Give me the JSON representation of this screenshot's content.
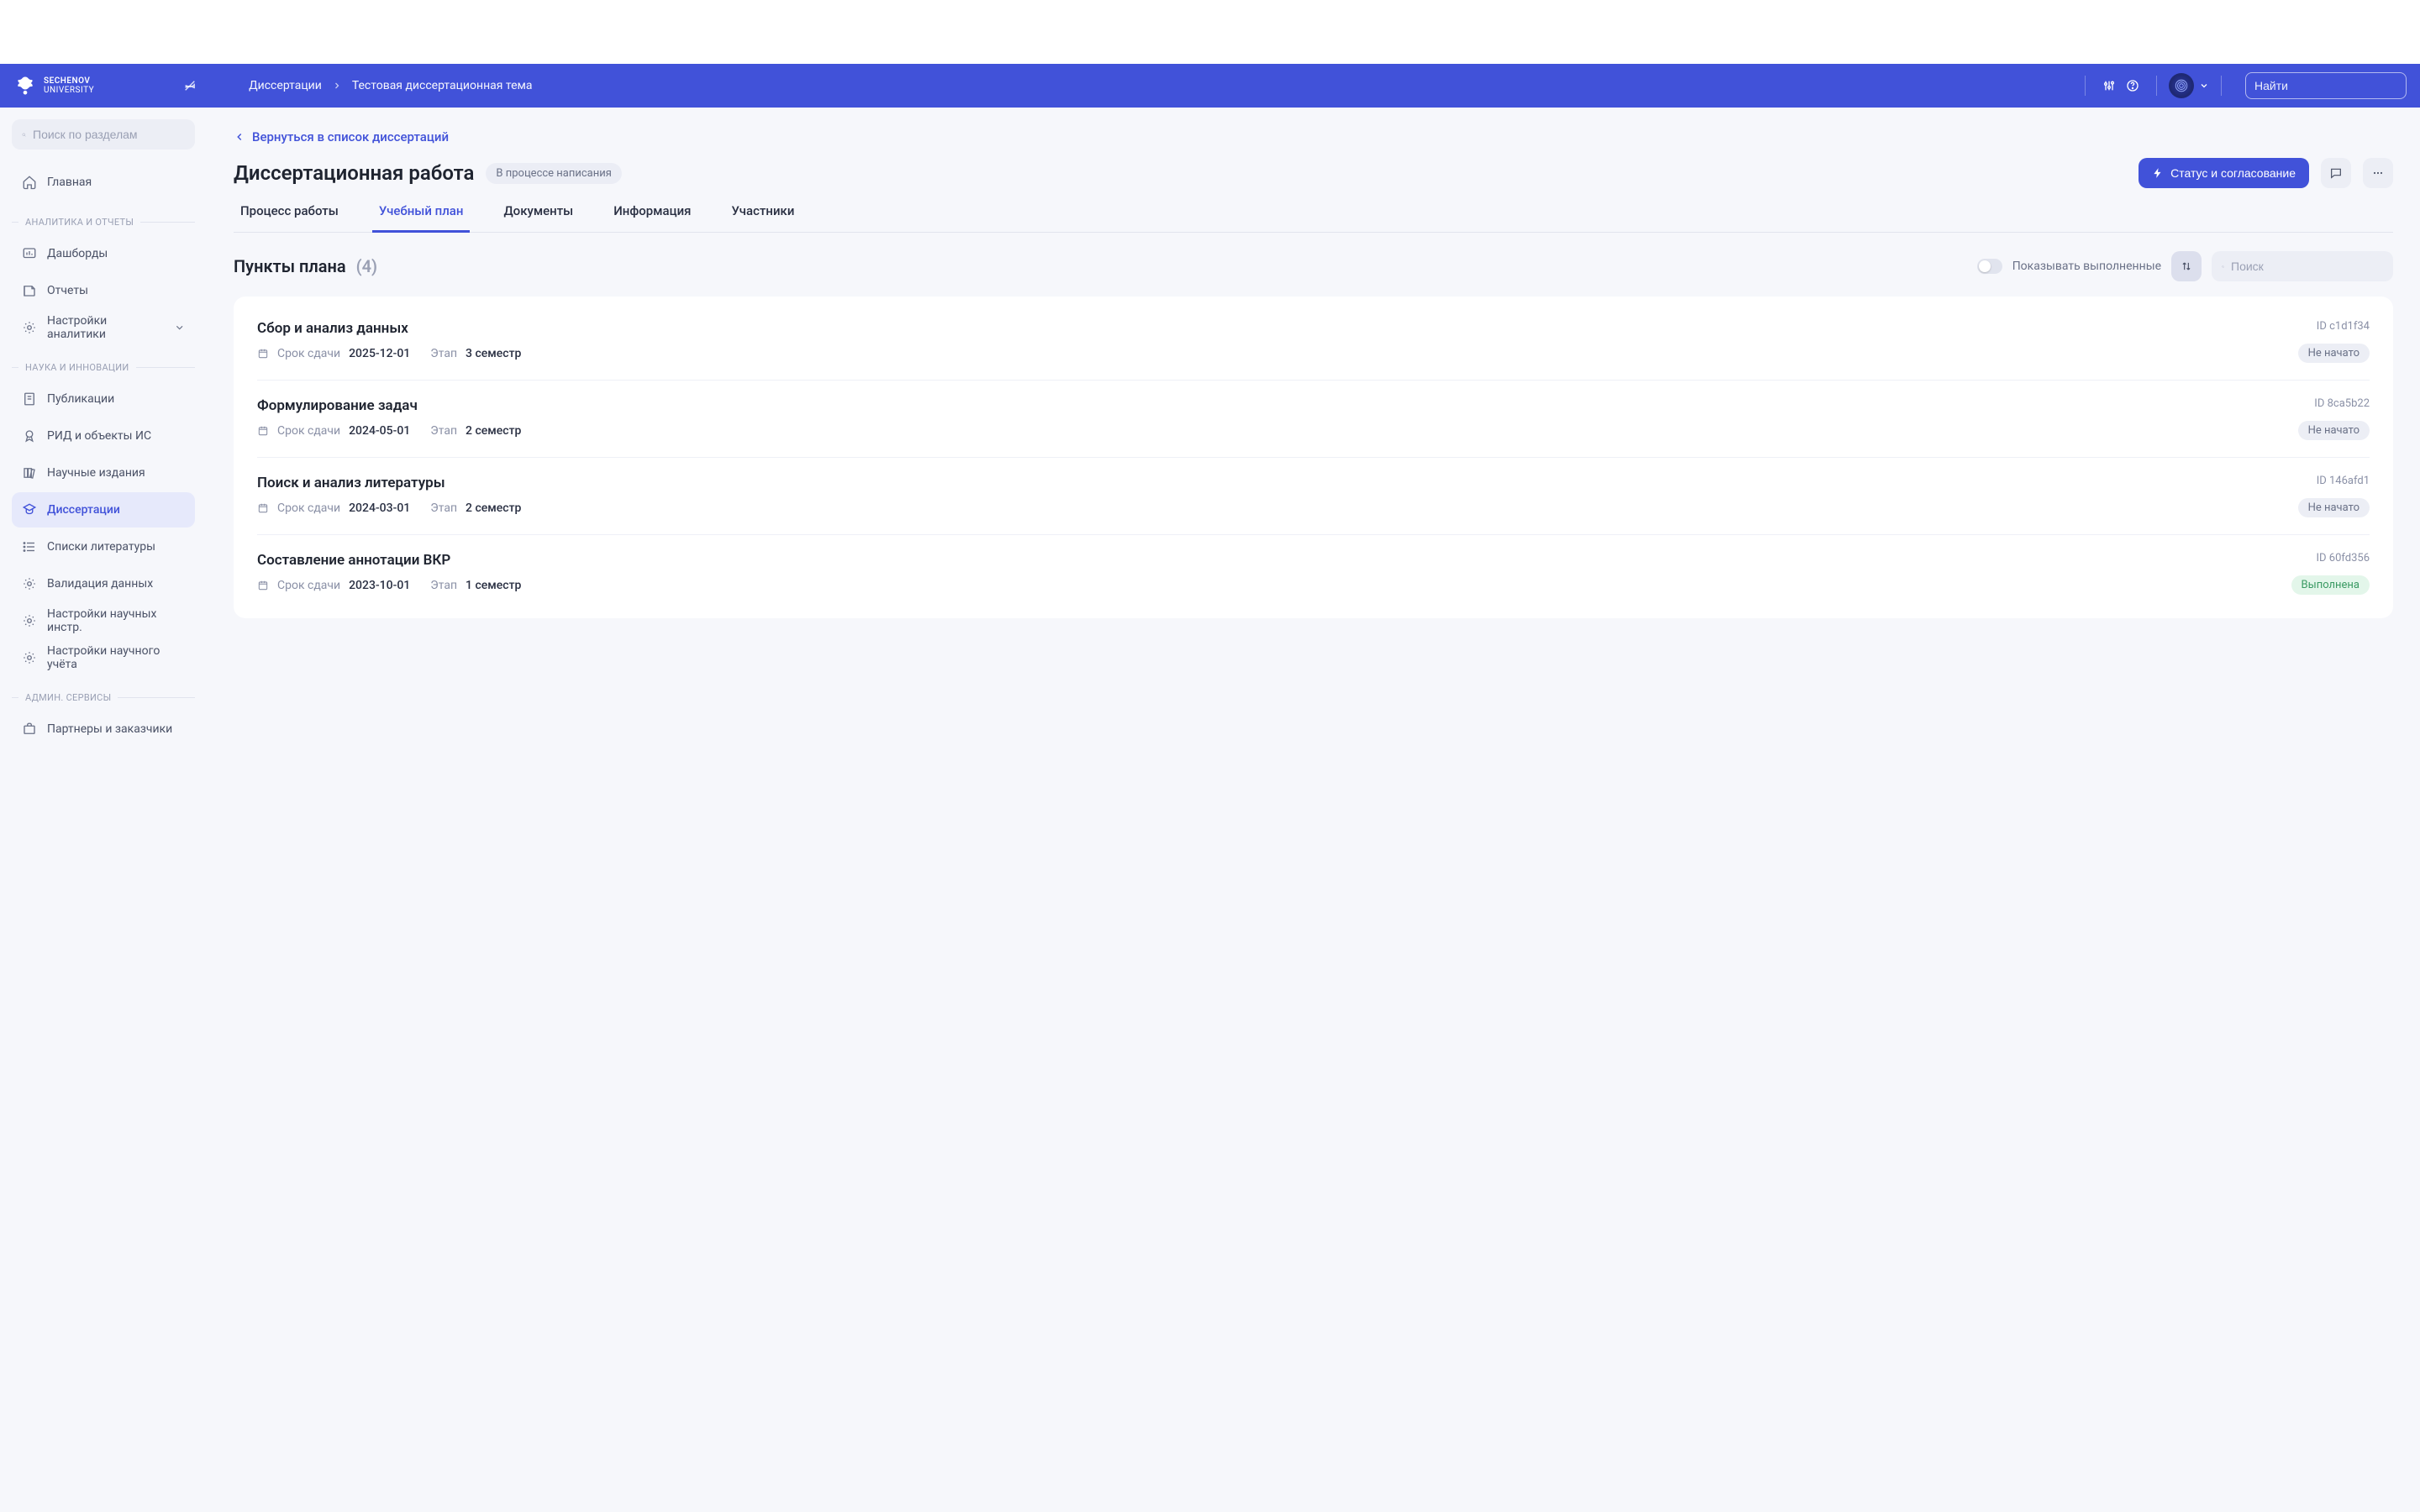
{
  "brand": {
    "line1": "SECHENOV",
    "line2": "UNIVERSITY"
  },
  "breadcrumb": {
    "root": "Диссертации",
    "current": "Тестовая диссертационная тема"
  },
  "global_search_placeholder": "Найти",
  "sidebar": {
    "search_placeholder": "Поиск по разделам",
    "home": "Главная",
    "sections": [
      {
        "label": "АНАЛИТИКА И ОТЧЕТЫ",
        "items": [
          {
            "key": "dashboards",
            "label": "Дашборды"
          },
          {
            "key": "reports",
            "label": "Отчеты"
          },
          {
            "key": "analytics-settings",
            "label": "Настройки аналитики",
            "chevron": true
          }
        ]
      },
      {
        "label": "НАУКА И ИННОВАЦИИ",
        "items": [
          {
            "key": "publications",
            "label": "Публикации"
          },
          {
            "key": "rid",
            "label": "РИД и объекты ИС"
          },
          {
            "key": "journals",
            "label": "Научные издания"
          },
          {
            "key": "dissertations",
            "label": "Диссертации",
            "active": true
          },
          {
            "key": "bibliography",
            "label": "Списки литературы"
          },
          {
            "key": "validation",
            "label": "Валидация данных"
          },
          {
            "key": "sci-tools-settings",
            "label": "Настройки научных инстр."
          },
          {
            "key": "sci-account-settings",
            "label": "Настройки научного учёта"
          }
        ]
      },
      {
        "label": "АДМИН. СЕРВИСЫ",
        "items": [
          {
            "key": "partners",
            "label": "Партнеры и заказчики"
          }
        ]
      }
    ]
  },
  "back_link": "Вернуться в список диссертаций",
  "page_title": "Диссертационная работа",
  "status_badge": "В процессе написания",
  "primary_button": "Статус и согласование",
  "tabs": [
    {
      "key": "process",
      "label": "Процесс работы"
    },
    {
      "key": "plan",
      "label": "Учебный план",
      "active": true
    },
    {
      "key": "documents",
      "label": "Документы"
    },
    {
      "key": "info",
      "label": "Информация"
    },
    {
      "key": "members",
      "label": "Участники"
    }
  ],
  "section": {
    "title": "Пункты плана",
    "count": "(4)",
    "toggle_label": "Показывать выполненные",
    "search_placeholder": "Поиск"
  },
  "meta_labels": {
    "due": "Срок сдачи",
    "stage": "Этап",
    "id_prefix": "ID"
  },
  "status_labels": {
    "not_started": "Не начато",
    "done": "Выполнена"
  },
  "plan_items": [
    {
      "title": "Сбор и анализ данных",
      "due": "2025-12-01",
      "stage": "3 семестр",
      "id": "c1d1f34",
      "status": "not_started"
    },
    {
      "title": "Формулирование задач",
      "due": "2024-05-01",
      "stage": "2 семестр",
      "id": "8ca5b22",
      "status": "not_started"
    },
    {
      "title": "Поиск и анализ литературы",
      "due": "2024-03-01",
      "stage": "2 семестр",
      "id": "146afd1",
      "status": "not_started"
    },
    {
      "title": "Составление аннотации ВКР",
      "due": "2023-10-01",
      "stage": "1 семестр",
      "id": "60fd356",
      "status": "done"
    }
  ]
}
